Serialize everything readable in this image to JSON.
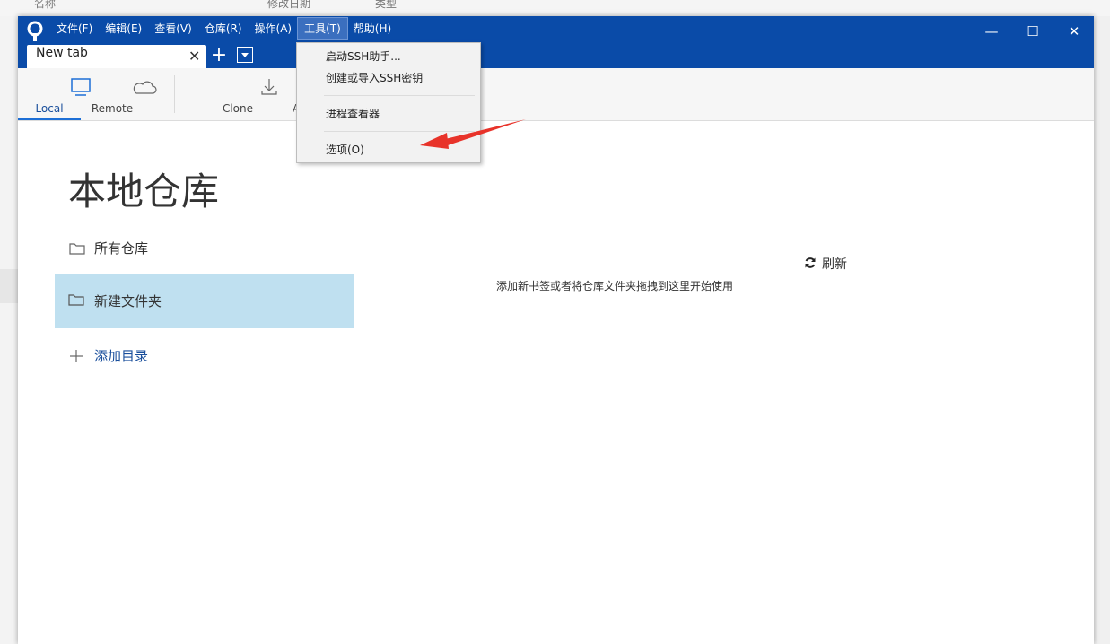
{
  "background": {
    "columns": [
      "名称",
      "修改日期",
      "类型"
    ]
  },
  "menubar": {
    "items": [
      "文件(F)",
      "编辑(E)",
      "查看(V)",
      "仓库(R)",
      "操作(A)",
      "工具(T)",
      "帮助(H)"
    ],
    "active_index": 5
  },
  "window_controls": {
    "minimize": "—",
    "maximize": "☐",
    "close": "✕"
  },
  "tabs": {
    "active_label": "New tab",
    "close": "✕",
    "add": "+"
  },
  "toolbar": {
    "local": "Local",
    "remote": "Remote",
    "clone": "Clone",
    "add_partial": "A"
  },
  "main": {
    "title": "本地仓库",
    "all_repos": "所有仓库",
    "new_folder": "新建文件夹",
    "add_directory": "添加目录",
    "refresh": "刷新",
    "empty_hint": "添加新书签或者将仓库文件夹拖拽到这里开始使用"
  },
  "tools_menu": {
    "ssh_agent": "启动SSH助手...",
    "ssh_keys": "创建或导入SSH密钥",
    "process_viewer": "进程查看器",
    "options": "选项(O)"
  },
  "colors": {
    "titlebar": "#0a4ba8",
    "selected_item": "#bfe0f0",
    "accent": "#1d6fd6",
    "annotation_arrow": "#e8332a"
  }
}
